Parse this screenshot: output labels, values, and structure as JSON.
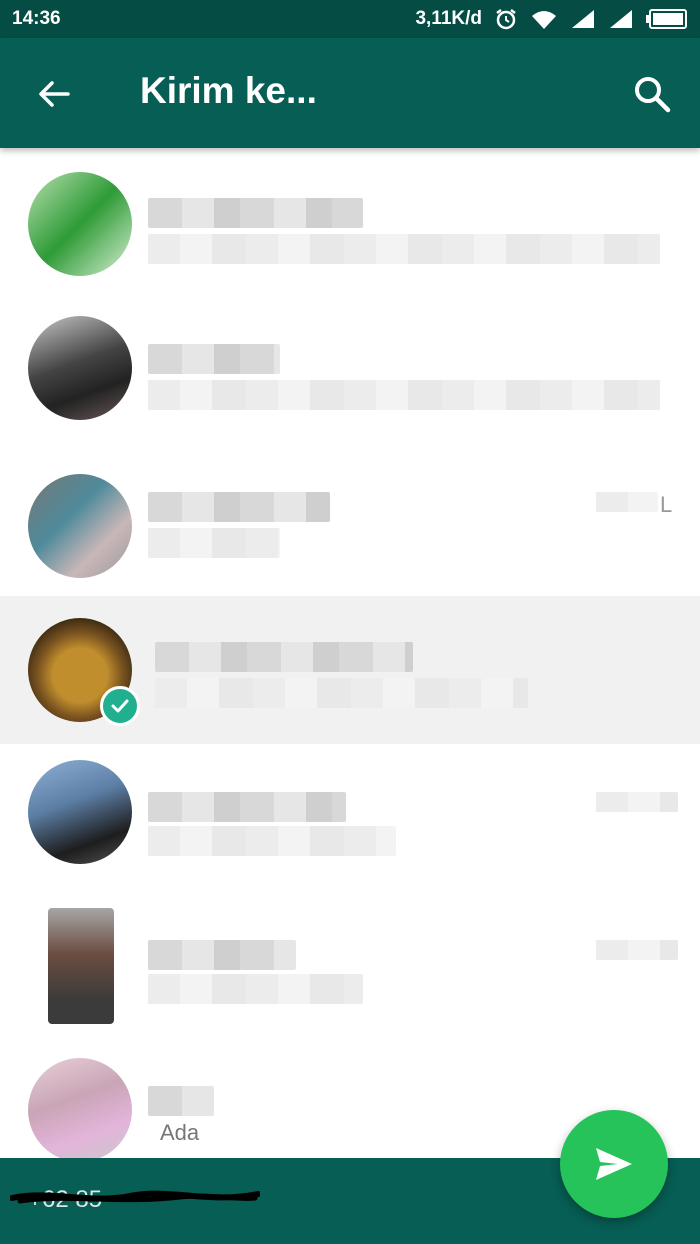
{
  "status_bar": {
    "time": "14:36",
    "net_speed": "3,11K/d",
    "icons": [
      "alarm-icon",
      "wifi-icon",
      "signal-icon",
      "signal-icon",
      "battery-icon"
    ]
  },
  "app_bar": {
    "title": "Kirim ke...",
    "back_icon": "arrow-left-icon",
    "search_icon": "search-icon"
  },
  "contacts": [
    {
      "name": "",
      "status": "",
      "selected": false,
      "time": ""
    },
    {
      "name": "",
      "status": "",
      "selected": false,
      "time": ""
    },
    {
      "name": "",
      "status": "",
      "selected": false,
      "time": "L"
    },
    {
      "name": "",
      "status": "",
      "selected": true,
      "time": ""
    },
    {
      "name": "",
      "status": "",
      "selected": false,
      "time": ""
    },
    {
      "name": "",
      "status": "",
      "selected": false,
      "time": ""
    },
    {
      "name": "",
      "status": "Ada",
      "selected": false,
      "time": ""
    }
  ],
  "bottom_bar": {
    "recipients": "+62 85"
  },
  "fab": {
    "icon": "send-icon"
  },
  "colors": {
    "primary": "#075e54",
    "primary_dark": "#054d44",
    "accent": "#25c35a",
    "check": "#21b08f"
  }
}
